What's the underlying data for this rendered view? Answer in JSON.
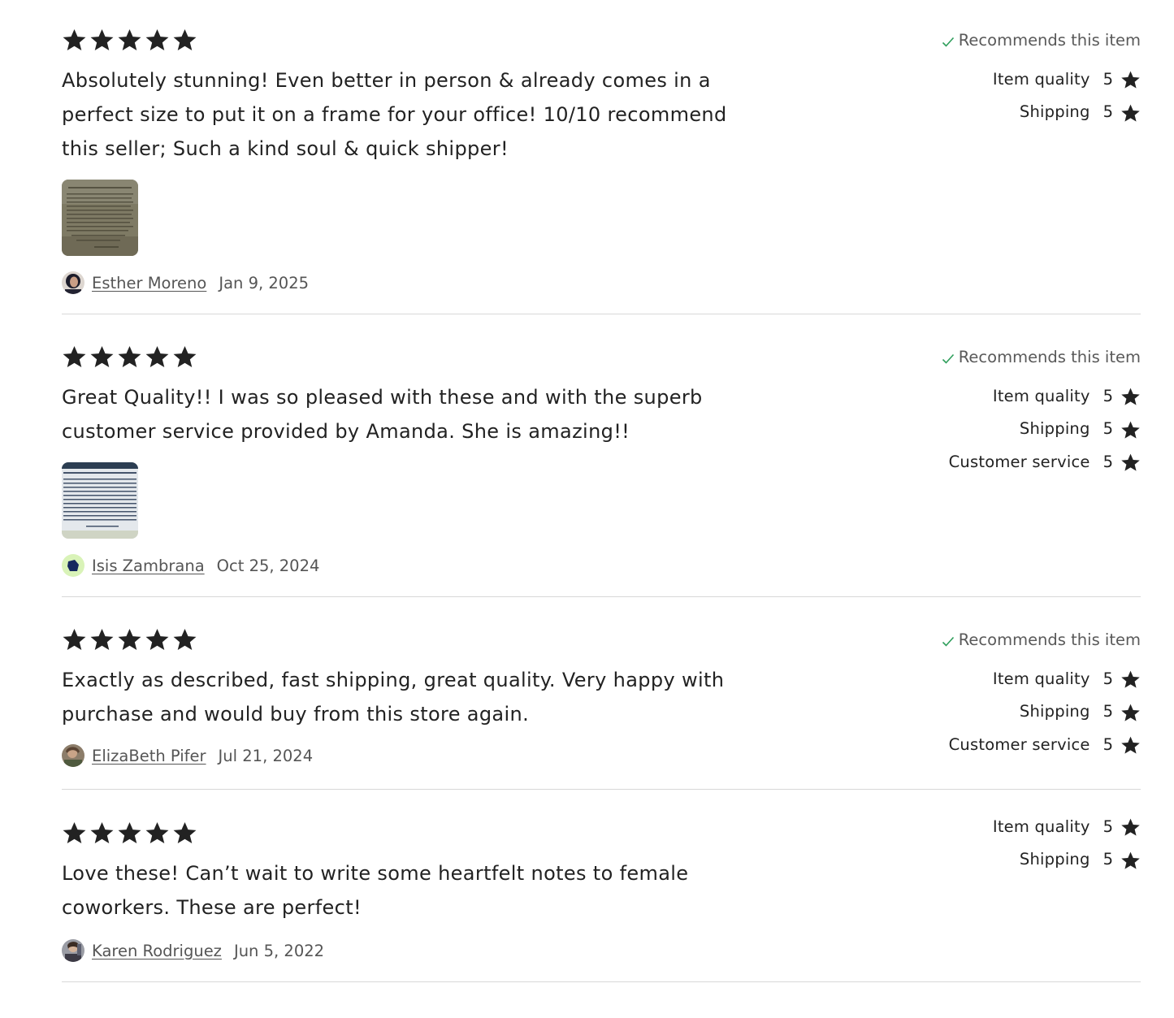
{
  "reviews": [
    {
      "rating": 5,
      "text": "Absolutely stunning! Even better in person & already comes in a perfect size to put it on a frame for your office! 10/10 recommend this seller; Such a kind soul & quick shipper!",
      "has_photo": true,
      "author": "Esther Moreno",
      "date": "Jan 9, 2025",
      "recommends": "Recommends this item",
      "metrics": [
        {
          "label": "Item quality",
          "score": "5"
        },
        {
          "label": "Shipping",
          "score": "5"
        }
      ]
    },
    {
      "rating": 5,
      "text": "Great Quality!! I was so pleased with these and with the superb customer service provided by Amanda. She is amazing!!",
      "has_photo": true,
      "author": "Isis Zambrana",
      "date": "Oct 25, 2024",
      "recommends": "Recommends this item",
      "metrics": [
        {
          "label": "Item quality",
          "score": "5"
        },
        {
          "label": "Shipping",
          "score": "5"
        },
        {
          "label": "Customer service",
          "score": "5"
        }
      ]
    },
    {
      "rating": 5,
      "text": "Exactly as described, fast shipping, great quality. Very happy with purchase and would buy from this store again.",
      "has_photo": false,
      "author": "ElizaBeth Pifer",
      "date": "Jul 21, 2024",
      "recommends": "Recommends this item",
      "metrics": [
        {
          "label": "Item quality",
          "score": "5"
        },
        {
          "label": "Shipping",
          "score": "5"
        },
        {
          "label": "Customer service",
          "score": "5"
        }
      ]
    },
    {
      "rating": 5,
      "text": "Love these! Can’t wait to write some heartfelt notes to female coworkers. These are perfect!",
      "has_photo": false,
      "author": "Karen Rodriguez",
      "date": "Jun 5, 2022",
      "recommends": "",
      "metrics": [
        {
          "label": "Item quality",
          "score": "5"
        },
        {
          "label": "Shipping",
          "score": "5"
        }
      ]
    }
  ],
  "colors": {
    "star": "#222222",
    "check": "#2e9e5b",
    "muted_text": "#595959",
    "divider": "#d8d8d8"
  },
  "icons": [
    "star-icon",
    "check-icon",
    "avatar"
  ]
}
